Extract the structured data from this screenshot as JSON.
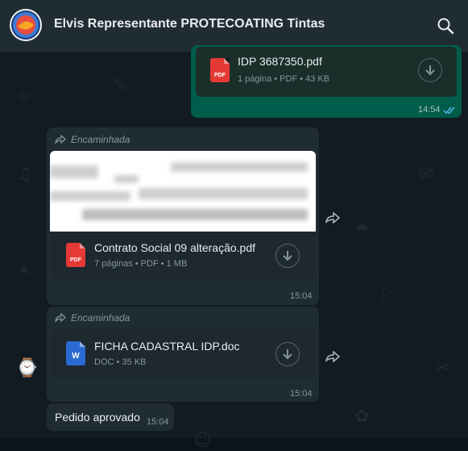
{
  "header": {
    "title": "Elvis Representante PROTECOATING Tintas"
  },
  "messages": {
    "m1": {
      "file_name": "IDP 3687350.pdf",
      "file_meta": "1 página • PDF • 43 KB",
      "icon_label": "PDF",
      "time": "14:54"
    },
    "m2": {
      "forwarded_label": "Encaminhada",
      "file_name": "Contrato Social 09 alteração.pdf",
      "file_meta": "7 páginas • PDF • 1 MB",
      "icon_label": "PDF",
      "time": "15:04"
    },
    "m3": {
      "forwarded_label": "Encaminhada",
      "file_name": "FICHA CADASTRAL IDP.doc",
      "file_meta": "DOC • 35 KB",
      "icon_label": "W",
      "time": "15:04"
    },
    "m4": {
      "text": "Pedido aprovado",
      "time": "15:04"
    }
  },
  "colors": {
    "outgoing": "#005c4b",
    "incoming": "#202c33",
    "header": "#202c33",
    "read_ticks": "#53bdeb"
  }
}
